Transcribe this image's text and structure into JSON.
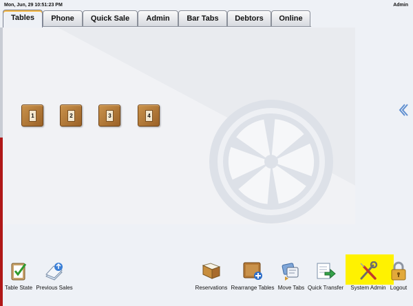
{
  "header": {
    "datetime": "Mon, Jun, 29  10:51:23 PM",
    "user": "Admin"
  },
  "tabs": [
    {
      "label": "Tables",
      "active": true
    },
    {
      "label": "Phone",
      "active": false
    },
    {
      "label": "Quick Sale",
      "active": false
    },
    {
      "label": "Admin",
      "active": false
    },
    {
      "label": "Bar Tabs",
      "active": false
    },
    {
      "label": "Debtors",
      "active": false
    },
    {
      "label": "Online",
      "active": false
    }
  ],
  "floor": {
    "tables": [
      "1",
      "2",
      "3",
      "4"
    ]
  },
  "toolbar": {
    "left": [
      {
        "label": "Table State",
        "icon": "clipboard-check-icon"
      },
      {
        "label": "Previous Sales",
        "icon": "paper-stack-icon"
      }
    ],
    "right": [
      {
        "label": "Reservations",
        "icon": "book-icon"
      },
      {
        "label": "Rearrange Tables",
        "icon": "table-plus-icon"
      },
      {
        "label": "Move Tabs",
        "icon": "cards-icon"
      },
      {
        "label": "Quick Transfer",
        "icon": "transfer-arrow-icon"
      },
      {
        "label": "System Admin",
        "icon": "wrench-screwdriver-icon"
      },
      {
        "label": "Logout",
        "icon": "padlock-icon"
      }
    ]
  },
  "colors": {
    "highlight": "#fff200",
    "wood": "#a86b2c",
    "active_tab_accent": "#f4b43a"
  }
}
